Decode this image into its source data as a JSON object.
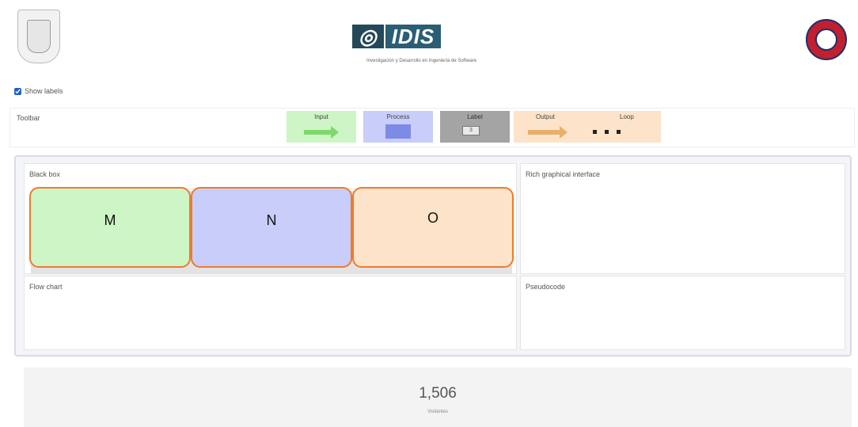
{
  "header": {
    "left_logo_icon": "university-seal-icon",
    "center_logo": {
      "mark": "IDIS",
      "tagline": "Investigación y Desarrollo en Ingeniería de Software",
      "color": "#2b5e74"
    },
    "right_logo_icon": "university-crest-icon"
  },
  "show_labels": {
    "label": "Show labels",
    "checked": true
  },
  "toolbar": {
    "title": "Toolbar",
    "tools": {
      "input": {
        "label": "Input",
        "color": "#cdf5c5",
        "icon": "green-arrow-icon"
      },
      "process": {
        "label": "Process",
        "color": "#c8cdfa",
        "icon": "process-block-icon"
      },
      "label": {
        "label": "Label",
        "value": "3",
        "color": "#a4a4a4"
      },
      "output": {
        "label": "Output",
        "color": "#fce3c9",
        "icon": "orange-arrow-icon"
      },
      "loop": {
        "label": "Loop",
        "icon": "dots-icon"
      }
    }
  },
  "panels": {
    "black_box": {
      "title": "Black box",
      "boxes": [
        {
          "label": "M",
          "color": "#cdf5c5"
        },
        {
          "label": "N",
          "color": "#c8cdfa"
        },
        {
          "label": "O",
          "color": "#fce3c9"
        }
      ],
      "box_border_color": "#ee7b2b"
    },
    "rich_interface": {
      "title": "Rich graphical interface"
    },
    "flow_chart": {
      "title": "Flow chart"
    },
    "pseudocode": {
      "title": "Pseudocode"
    }
  },
  "visitors": {
    "count": "1,506",
    "label": "Visitantes"
  }
}
